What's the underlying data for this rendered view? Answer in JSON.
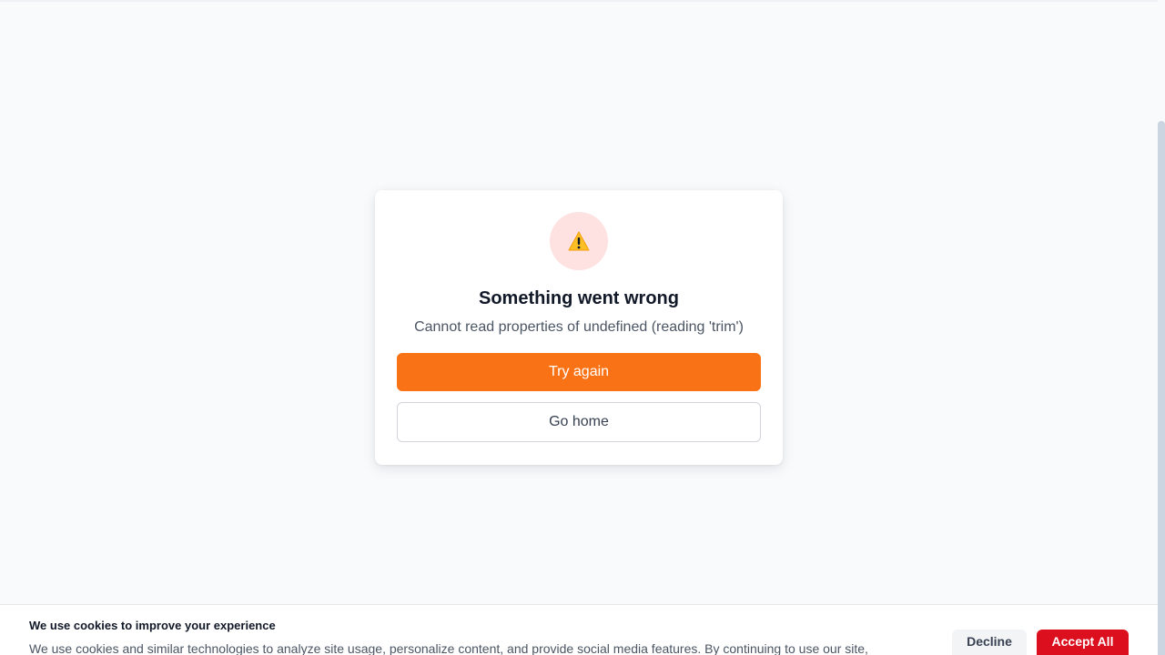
{
  "error": {
    "icon": "warning-icon",
    "title": "Something went wrong",
    "message": "Cannot read properties of undefined (reading 'trim')",
    "primary_button": "Try again",
    "secondary_button": "Go home"
  },
  "cookie_banner": {
    "title": "We use cookies to improve your experience",
    "text": "We use cookies and similar technologies to analyze site usage, personalize content, and provide social media features. By continuing to use our site,",
    "decline_label": "Decline",
    "accept_label": "Accept All"
  },
  "colors": {
    "accent": "#f97316",
    "accept": "#dc0f1e",
    "icon_bg": "#fee2e2",
    "page_bg": "#f8fafc"
  }
}
